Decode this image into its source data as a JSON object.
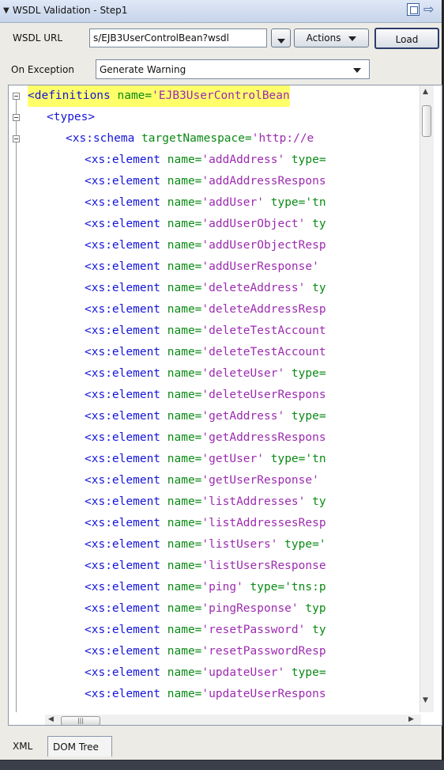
{
  "window": {
    "title": "WSDL Validation - Step1"
  },
  "form": {
    "wsdl_url_label": "WSDL URL",
    "wsdl_url_value": "s/EJB3UserControlBean?wsdl",
    "actions_label": "Actions",
    "load_label": "Load",
    "on_exception_label": "On Exception",
    "on_exception_value": "Generate Warning"
  },
  "editor": {
    "lines": [
      {
        "indent": 0,
        "tag": "<definitions",
        "attr": " name=",
        "val": "'EJB3UserControlBean",
        "rest": ""
      },
      {
        "indent": 1,
        "tag": "<types>",
        "attr": "",
        "val": "",
        "rest": ""
      },
      {
        "indent": 2,
        "tag": "<xs:schema",
        "attr": " targetNamespace=",
        "val": "'http://e",
        "rest": ""
      },
      {
        "indent": 3,
        "tag": "<xs:element",
        "attr": " name=",
        "val": "'addAddress'",
        "rest": " type="
      },
      {
        "indent": 3,
        "tag": "<xs:element",
        "attr": " name=",
        "val": "'addAddressRespons",
        "rest": ""
      },
      {
        "indent": 3,
        "tag": "<xs:element",
        "attr": " name=",
        "val": "'addUser'",
        "rest": " type='tn"
      },
      {
        "indent": 3,
        "tag": "<xs:element",
        "attr": " name=",
        "val": "'addUserObject'",
        "rest": " ty"
      },
      {
        "indent": 3,
        "tag": "<xs:element",
        "attr": " name=",
        "val": "'addUserObjectResp",
        "rest": ""
      },
      {
        "indent": 3,
        "tag": "<xs:element",
        "attr": " name=",
        "val": "'addUserResponse'",
        "rest": ""
      },
      {
        "indent": 3,
        "tag": "<xs:element",
        "attr": " name=",
        "val": "'deleteAddress'",
        "rest": " ty"
      },
      {
        "indent": 3,
        "tag": "<xs:element",
        "attr": " name=",
        "val": "'deleteAddressResp",
        "rest": ""
      },
      {
        "indent": 3,
        "tag": "<xs:element",
        "attr": " name=",
        "val": "'deleteTestAccount",
        "rest": ""
      },
      {
        "indent": 3,
        "tag": "<xs:element",
        "attr": " name=",
        "val": "'deleteTestAccount",
        "rest": ""
      },
      {
        "indent": 3,
        "tag": "<xs:element",
        "attr": " name=",
        "val": "'deleteUser'",
        "rest": " type="
      },
      {
        "indent": 3,
        "tag": "<xs:element",
        "attr": " name=",
        "val": "'deleteUserRespons",
        "rest": ""
      },
      {
        "indent": 3,
        "tag": "<xs:element",
        "attr": " name=",
        "val": "'getAddress'",
        "rest": " type="
      },
      {
        "indent": 3,
        "tag": "<xs:element",
        "attr": " name=",
        "val": "'getAddressRespons",
        "rest": ""
      },
      {
        "indent": 3,
        "tag": "<xs:element",
        "attr": " name=",
        "val": "'getUser'",
        "rest": " type='tn"
      },
      {
        "indent": 3,
        "tag": "<xs:element",
        "attr": " name=",
        "val": "'getUserResponse'",
        "rest": ""
      },
      {
        "indent": 3,
        "tag": "<xs:element",
        "attr": " name=",
        "val": "'listAddresses'",
        "rest": " ty"
      },
      {
        "indent": 3,
        "tag": "<xs:element",
        "attr": " name=",
        "val": "'listAddressesResp",
        "rest": ""
      },
      {
        "indent": 3,
        "tag": "<xs:element",
        "attr": " name=",
        "val": "'listUsers'",
        "rest": " type='"
      },
      {
        "indent": 3,
        "tag": "<xs:element",
        "attr": " name=",
        "val": "'listUsersResponse",
        "rest": ""
      },
      {
        "indent": 3,
        "tag": "<xs:element",
        "attr": " name=",
        "val": "'ping'",
        "rest": " type='tns:p"
      },
      {
        "indent": 3,
        "tag": "<xs:element",
        "attr": " name=",
        "val": "'pingResponse'",
        "rest": " typ"
      },
      {
        "indent": 3,
        "tag": "<xs:element",
        "attr": " name=",
        "val": "'resetPassword'",
        "rest": " ty"
      },
      {
        "indent": 3,
        "tag": "<xs:element",
        "attr": " name=",
        "val": "'resetPasswordResp",
        "rest": ""
      },
      {
        "indent": 3,
        "tag": "<xs:element",
        "attr": " name=",
        "val": "'updateUser'",
        "rest": " type="
      },
      {
        "indent": 3,
        "tag": "<xs:element",
        "attr": " name=",
        "val": "'updateUserRespons",
        "rest": ""
      }
    ]
  },
  "tabs": [
    "XML",
    "DOM Tree"
  ],
  "colors": {
    "tag": "#1515d8",
    "attribute": "#0a8a14",
    "value": "#9c2bb0",
    "highlight": "#ffff6a"
  }
}
